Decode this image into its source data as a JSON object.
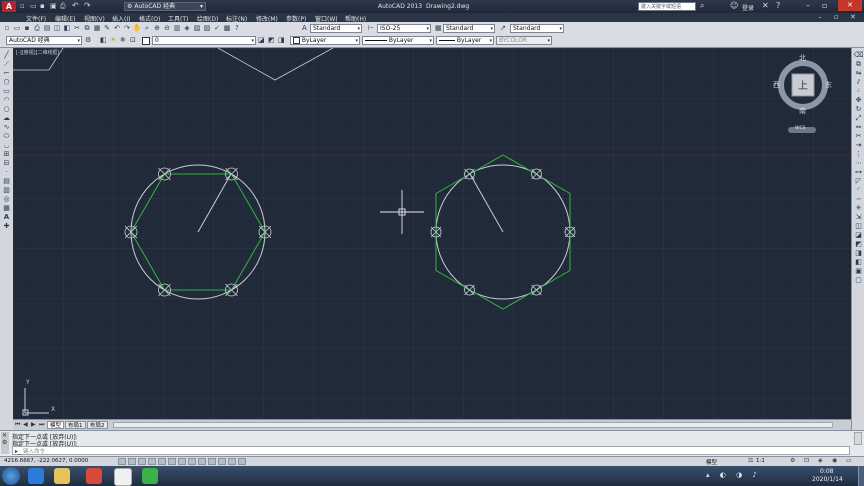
{
  "titlebar": {
    "workspace": "AutoCAD 经典",
    "app_title": "AutoCAD 2013",
    "doc_title": "Drawing2.dwg",
    "search_placeholder": "键入关键字或短语",
    "login": "登录"
  },
  "menu": [
    "文件(F)",
    "编辑(E)",
    "视图(V)",
    "插入(I)",
    "格式(O)",
    "工具(T)",
    "绘图(D)",
    "标注(N)",
    "修改(M)",
    "参数(P)",
    "窗口(W)",
    "帮助(H)"
  ],
  "toolbar": {
    "text_style": "Standard",
    "dim_style": "ISO-25",
    "table_style": "Standard",
    "mleader_style": "Standard",
    "workspace2": "AutoCAD 经典",
    "layer": "0",
    "color": "ByLayer",
    "linetype": "ByLayer",
    "lineweight": "ByLayer",
    "plotstyle": "BYCOLOR"
  },
  "viewport": {
    "label": "[-][俯视][二维线框]"
  },
  "viewcube": {
    "north": "北",
    "south": "南",
    "east": "东",
    "west": "西",
    "top": "上",
    "wcs": "WCS"
  },
  "ucs": {
    "x": "X",
    "y": "Y"
  },
  "tabs": [
    "模型",
    "布局1",
    "布局2"
  ],
  "command": {
    "line1": "指定下一点或 [放弃(U)]:",
    "line2": "指定下一点或 [放弃(U)]:",
    "prompt": "键入命令"
  },
  "status": {
    "coords": "4216.6667, -222.0627, 0.0000",
    "model": "模型",
    "scale": "1:1"
  },
  "taskbar": {
    "time": "0:08",
    "date": "2020/1/14"
  },
  "colors": {
    "canvas": "#212a38",
    "grid": "#2b3546",
    "circle": "#c8cdd4",
    "hexagon": "#35b345",
    "axis_red": "#5a2a30"
  }
}
